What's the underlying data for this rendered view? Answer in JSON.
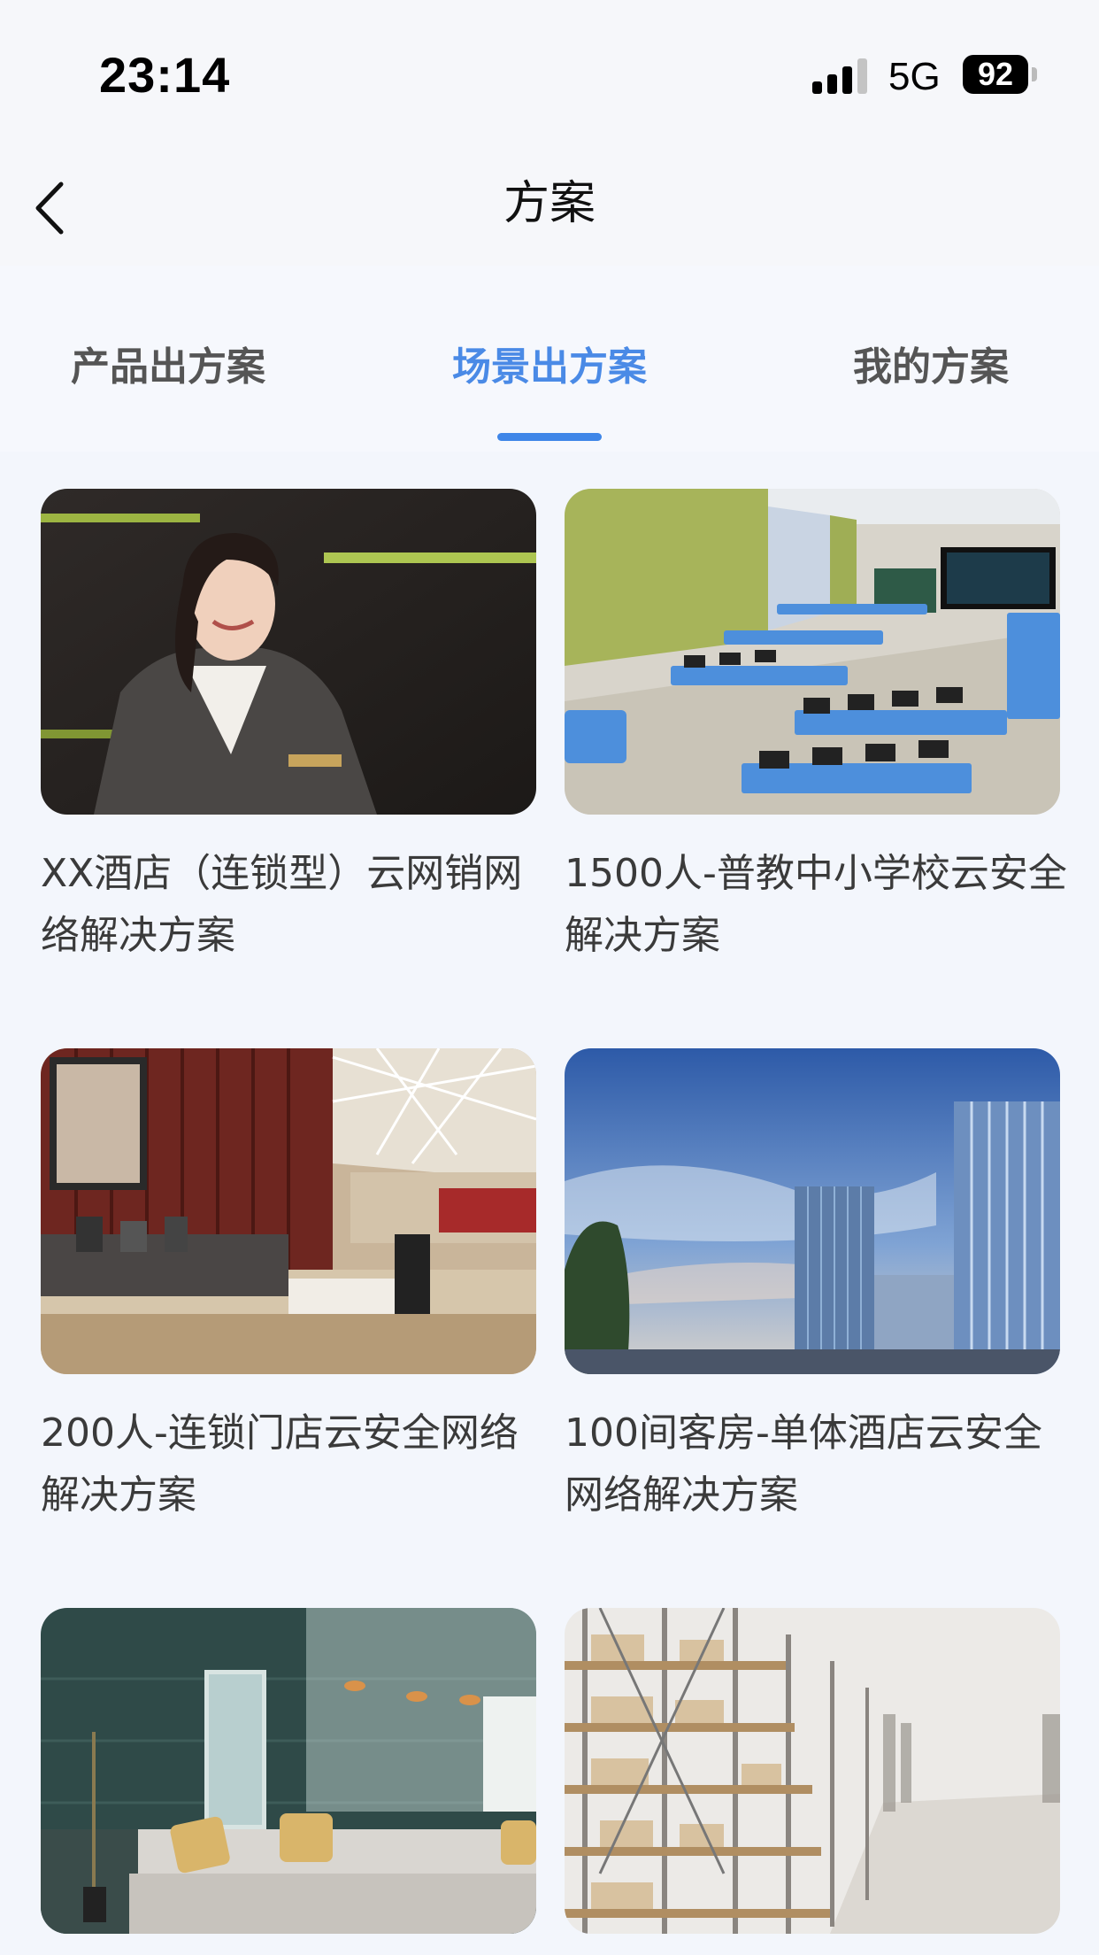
{
  "status_bar": {
    "time": "23:14",
    "network": "5G",
    "battery": "92"
  },
  "nav": {
    "title": "方案"
  },
  "tabs": [
    {
      "label": "产品出方案",
      "active": false
    },
    {
      "label": "场景出方案",
      "active": true
    },
    {
      "label": "我的方案",
      "active": false
    }
  ],
  "colors": {
    "accent": "#3f86e8",
    "background": "#f3f6fc"
  },
  "solutions": [
    {
      "title": "XX酒店（连锁型）云网销网络解决方案",
      "image": "hotel-receptionist"
    },
    {
      "title": "1500人-普教中小学校云安全解决方案",
      "image": "school-classroom"
    },
    {
      "title": "200人-连锁门店云安全网络解决方案",
      "image": "coffee-shop"
    },
    {
      "title": "100间客房-单体酒店云安全网络解决方案",
      "image": "office-buildings"
    },
    {
      "title": "",
      "image": "lobby-lounge"
    },
    {
      "title": "",
      "image": "warehouse-shelves"
    }
  ]
}
